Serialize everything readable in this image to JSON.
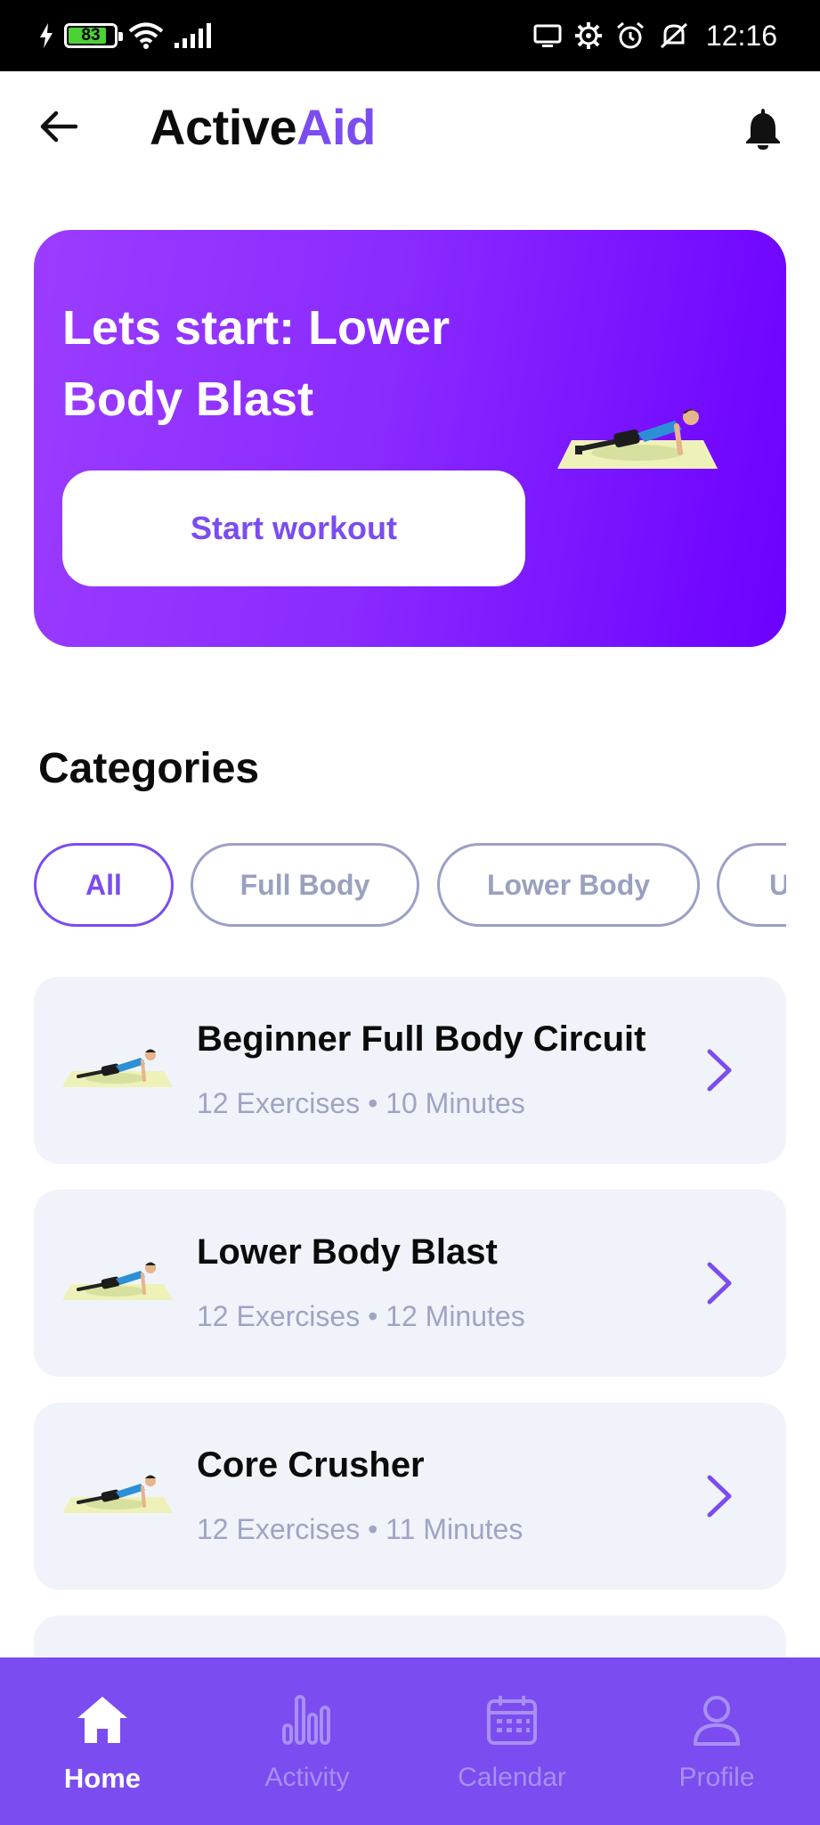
{
  "status_bar": {
    "battery": "83",
    "battery_level": 0.83,
    "time": "12:16",
    "icons": [
      "charging-icon",
      "battery-icon",
      "wifi-icon",
      "signal-icon",
      "cast-icon",
      "settings-icon",
      "alarm-icon",
      "mute-icon"
    ]
  },
  "header": {
    "brand_part1": "Active",
    "brand_part2": "Aid",
    "back_icon": "arrow-left-icon",
    "notify_icon": "bell-icon"
  },
  "hero": {
    "title": "Lets start: Lower Body Blast",
    "button_label": "Start workout"
  },
  "categories": {
    "title": "Categories",
    "chips": [
      {
        "label": "All",
        "active": true
      },
      {
        "label": "Full Body",
        "active": false
      },
      {
        "label": "Lower Body",
        "active": false
      },
      {
        "label": "U",
        "active": false
      }
    ]
  },
  "workouts": [
    {
      "title": "Beginner Full Body Circuit",
      "meta": "12 Exercises • 10 Minutes"
    },
    {
      "title": "Lower Body Blast",
      "meta": "12 Exercises • 12 Minutes"
    },
    {
      "title": "Core Crusher",
      "meta": "12 Exercises • 11 Minutes"
    }
  ],
  "bottom_nav": [
    {
      "label": "Home",
      "icon": "home-icon",
      "active": true
    },
    {
      "label": "Activity",
      "icon": "bar-chart-icon",
      "active": false
    },
    {
      "label": "Calendar",
      "icon": "calendar-icon",
      "active": false
    },
    {
      "label": "Profile",
      "icon": "profile-icon",
      "active": false
    }
  ],
  "colors": {
    "accent": "#7b4cf0",
    "hero_gradient_start": "#9b3cff",
    "hero_gradient_end": "#6c00ff",
    "card_bg": "#f1f3fa",
    "muted_text": "#9ea4c4"
  }
}
